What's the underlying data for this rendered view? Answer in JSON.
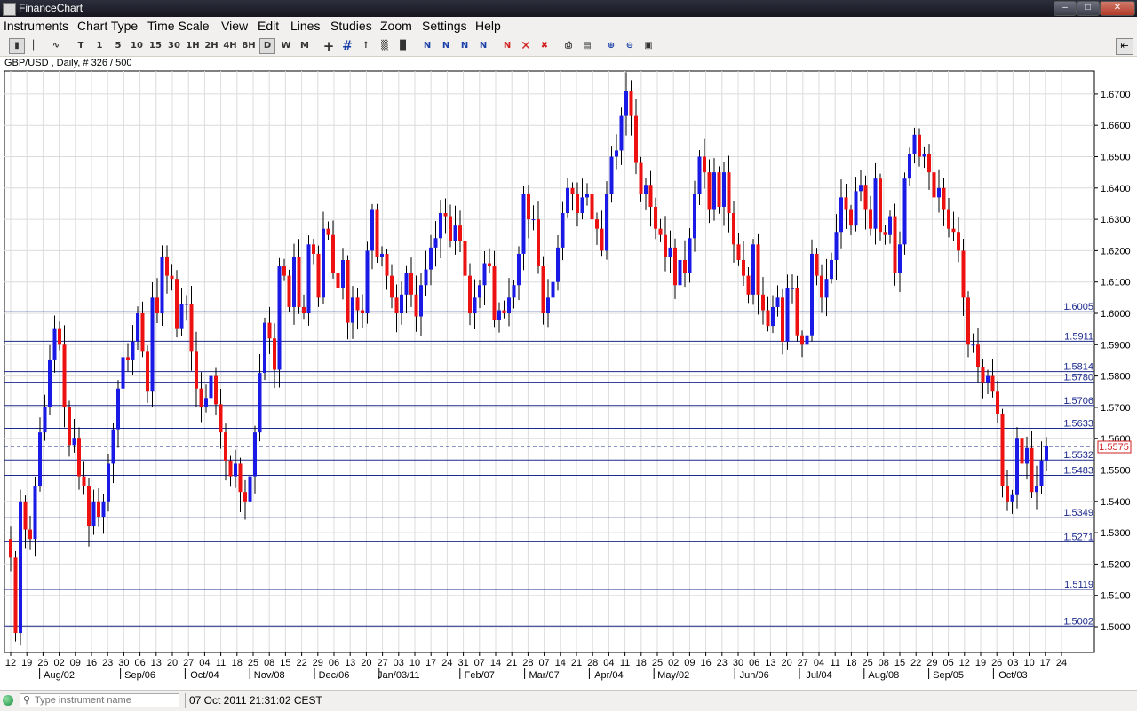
{
  "window": {
    "title": "FinanceChart"
  },
  "menu": [
    "Instruments",
    "Chart Type",
    "Time Scale",
    "View",
    "Edit",
    "Lines",
    "Studies",
    "Zoom",
    "Settings",
    "Help"
  ],
  "toolbar": {
    "timeframes": [
      "T",
      "1",
      "5",
      "10",
      "15",
      "30",
      "1H",
      "2H",
      "4H",
      "8H",
      "D",
      "W",
      "M"
    ],
    "selected_timeframe": "D"
  },
  "symbol_label": "GBP/USD , Daily, # 326 / 500",
  "status": {
    "search_placeholder": "Type instrument name",
    "datetime": "07 Oct 2011 21:31:02 CEST"
  },
  "colors": {
    "up": "#1a1ae6",
    "down": "#ee1111",
    "wick": "#000000",
    "level_line": "#1c2a8c",
    "grid": "#dcdcdc"
  },
  "chart_data": {
    "type": "candlestick",
    "instrument": "GBP/USD",
    "timeframe": "Daily",
    "ylim": [
      1.494,
      1.678
    ],
    "y_ticks": [
      "1.5000",
      "1.5100",
      "1.5200",
      "1.5300",
      "1.5400",
      "1.5500",
      "1.5600",
      "1.5700",
      "1.5800",
      "1.5900",
      "1.6000",
      "1.6100",
      "1.6200",
      "1.6300",
      "1.6400",
      "1.6500",
      "1.6600",
      "1.6700"
    ],
    "x_ticks": [
      "12",
      "19",
      "26",
      "02",
      "09",
      "16",
      "23",
      "30",
      "06",
      "13",
      "20",
      "27",
      "04",
      "11",
      "18",
      "25",
      "08",
      "15",
      "22",
      "29",
      "06",
      "13",
      "20",
      "27",
      "03",
      "10",
      "17",
      "24",
      "31",
      "07",
      "14",
      "21",
      "28",
      "07",
      "14",
      "21",
      "28",
      "04",
      "11",
      "18",
      "25",
      "02",
      "09",
      "16",
      "23",
      "30",
      "06",
      "13",
      "20",
      "27",
      "04",
      "11",
      "18",
      "25",
      "08",
      "15",
      "22",
      "29",
      "05",
      "12",
      "19",
      "26",
      "03",
      "10",
      "17",
      "24"
    ],
    "month_labels": [
      {
        "label": "Aug/02",
        "tick": 3
      },
      {
        "label": "Sep/06",
        "tick": 8
      },
      {
        "label": "Oct/04",
        "tick": 12
      },
      {
        "label": "Nov/08",
        "tick": 16
      },
      {
        "label": "Dec/06",
        "tick": 20
      },
      {
        "label": "Jan/03/11",
        "tick": 24
      },
      {
        "label": "Feb/07",
        "tick": 29
      },
      {
        "label": "Mar/07",
        "tick": 33
      },
      {
        "label": "Apr/04",
        "tick": 37
      },
      {
        "label": "May/02",
        "tick": 41
      },
      {
        "label": "Jun/06",
        "tick": 46
      },
      {
        "label": "Jul/04",
        "tick": 50
      },
      {
        "label": "Aug/08",
        "tick": 54
      },
      {
        "label": "Sep/05",
        "tick": 58
      },
      {
        "label": "Oct/03",
        "tick": 62
      }
    ],
    "levels": [
      "1.6005",
      "1.5911",
      "1.5814",
      "1.5780",
      "1.5706",
      "1.5633",
      "1.5532",
      "1.5483",
      "1.5349",
      "1.5271",
      "1.5119",
      "1.5002"
    ],
    "current_price": "1.5575",
    "close_path": [
      [
        0,
        1.522
      ],
      [
        1,
        1.498
      ],
      [
        2,
        1.54
      ],
      [
        3,
        1.531
      ],
      [
        4,
        1.528
      ],
      [
        5,
        1.545
      ],
      [
        6,
        1.562
      ],
      [
        7,
        1.57
      ],
      [
        8,
        1.585
      ],
      [
        9,
        1.595
      ],
      [
        10,
        1.59
      ],
      [
        11,
        1.57
      ],
      [
        12,
        1.558
      ],
      [
        13,
        1.56
      ],
      [
        14,
        1.548
      ],
      [
        15,
        1.545
      ],
      [
        16,
        1.532
      ],
      [
        17,
        1.54
      ],
      [
        18,
        1.535
      ],
      [
        19,
        1.54
      ],
      [
        20,
        1.552
      ],
      [
        21,
        1.563
      ],
      [
        22,
        1.576
      ],
      [
        23,
        1.586
      ],
      [
        24,
        1.585
      ],
      [
        25,
        1.591
      ],
      [
        26,
        1.6
      ],
      [
        27,
        1.588
      ],
      [
        28,
        1.575
      ],
      [
        29,
        1.605
      ],
      [
        30,
        1.6
      ],
      [
        31,
        1.618
      ],
      [
        32,
        1.612
      ],
      [
        33,
        1.611
      ],
      [
        34,
        1.595
      ],
      [
        35,
        1.603
      ],
      [
        36,
        1.603
      ],
      [
        37,
        1.588
      ],
      [
        38,
        1.576
      ],
      [
        39,
        1.57
      ],
      [
        40,
        1.573
      ],
      [
        41,
        1.58
      ],
      [
        42,
        1.571
      ],
      [
        43,
        1.562
      ],
      [
        44,
        1.553
      ],
      [
        45,
        1.548
      ],
      [
        46,
        1.552
      ],
      [
        47,
        1.543
      ],
      [
        48,
        1.54
      ],
      [
        49,
        1.548
      ],
      [
        50,
        1.562
      ],
      [
        51,
        1.581
      ],
      [
        52,
        1.597
      ],
      [
        53,
        1.592
      ],
      [
        54,
        1.582
      ],
      [
        55,
        1.615
      ],
      [
        56,
        1.612
      ],
      [
        57,
        1.602
      ],
      [
        58,
        1.618
      ],
      [
        59,
        1.602
      ],
      [
        60,
        1.6
      ],
      [
        61,
        1.622
      ],
      [
        62,
        1.619
      ],
      [
        63,
        1.605
      ],
      [
        64,
        1.627
      ],
      [
        65,
        1.625
      ],
      [
        66,
        1.613
      ],
      [
        67,
        1.608
      ],
      [
        68,
        1.617
      ],
      [
        69,
        1.597
      ],
      [
        70,
        1.605
      ],
      [
        71,
        1.601
      ],
      [
        72,
        1.6
      ],
      [
        73,
        1.62
      ],
      [
        74,
        1.633
      ],
      [
        75,
        1.618
      ],
      [
        76,
        1.619
      ],
      [
        77,
        1.612
      ],
      [
        78,
        1.605
      ],
      [
        79,
        1.6
      ],
      [
        80,
        1.606
      ],
      [
        81,
        1.613
      ],
      [
        82,
        1.606
      ],
      [
        83,
        1.599
      ],
      [
        84,
        1.609
      ],
      [
        85,
        1.614
      ],
      [
        86,
        1.621
      ],
      [
        87,
        1.624
      ],
      [
        88,
        1.632
      ],
      [
        89,
        1.631
      ],
      [
        90,
        1.623
      ],
      [
        91,
        1.628
      ],
      [
        92,
        1.623
      ],
      [
        93,
        1.612
      ],
      [
        94,
        1.6
      ],
      [
        95,
        1.605
      ],
      [
        96,
        1.609
      ],
      [
        97,
        1.616
      ],
      [
        98,
        1.615
      ],
      [
        99,
        1.598
      ],
      [
        100,
        1.601
      ],
      [
        101,
        1.6
      ],
      [
        102,
        1.605
      ],
      [
        103,
        1.609
      ],
      [
        104,
        1.619
      ],
      [
        105,
        1.638
      ],
      [
        106,
        1.63
      ],
      [
        107,
        1.63
      ],
      [
        108,
        1.615
      ],
      [
        109,
        1.6
      ],
      [
        110,
        1.605
      ],
      [
        111,
        1.61
      ],
      [
        112,
        1.621
      ],
      [
        113,
        1.632
      ],
      [
        114,
        1.64
      ],
      [
        115,
        1.638
      ],
      [
        116,
        1.632
      ],
      [
        117,
        1.637
      ],
      [
        118,
        1.638
      ],
      [
        119,
        1.63
      ],
      [
        120,
        1.627
      ],
      [
        121,
        1.62
      ],
      [
        122,
        1.638
      ],
      [
        123,
        1.65
      ],
      [
        124,
        1.652
      ],
      [
        125,
        1.663
      ],
      [
        126,
        1.671
      ],
      [
        127,
        1.663
      ],
      [
        128,
        1.648
      ],
      [
        129,
        1.638
      ],
      [
        130,
        1.641
      ],
      [
        131,
        1.634
      ],
      [
        132,
        1.627
      ],
      [
        133,
        1.625
      ],
      [
        134,
        1.618
      ],
      [
        135,
        1.621
      ],
      [
        136,
        1.609
      ],
      [
        137,
        1.617
      ],
      [
        138,
        1.613
      ],
      [
        139,
        1.624
      ],
      [
        140,
        1.638
      ],
      [
        141,
        1.65
      ],
      [
        142,
        1.645
      ],
      [
        143,
        1.633
      ],
      [
        144,
        1.645
      ],
      [
        145,
        1.634
      ],
      [
        146,
        1.645
      ],
      [
        147,
        1.632
      ],
      [
        148,
        1.622
      ],
      [
        149,
        1.617
      ],
      [
        150,
        1.612
      ],
      [
        151,
        1.606
      ],
      [
        152,
        1.622
      ],
      [
        153,
        1.606
      ],
      [
        154,
        1.601
      ],
      [
        155,
        1.596
      ],
      [
        156,
        1.602
      ],
      [
        157,
        1.605
      ],
      [
        158,
        1.591
      ],
      [
        159,
        1.608
      ],
      [
        160,
        1.608
      ],
      [
        161,
        1.593
      ],
      [
        162,
        1.59
      ],
      [
        163,
        1.593
      ],
      [
        164,
        1.619
      ],
      [
        165,
        1.612
      ],
      [
        166,
        1.605
      ],
      [
        167,
        1.611
      ],
      [
        168,
        1.617
      ],
      [
        169,
        1.626
      ],
      [
        170,
        1.637
      ],
      [
        171,
        1.633
      ],
      [
        172,
        1.628
      ],
      [
        173,
        1.639
      ],
      [
        174,
        1.641
      ],
      [
        175,
        1.633
      ],
      [
        176,
        1.627
      ],
      [
        177,
        1.643
      ],
      [
        178,
        1.626
      ],
      [
        179,
        1.625
      ],
      [
        180,
        1.631
      ],
      [
        181,
        1.613
      ],
      [
        182,
        1.622
      ],
      [
        183,
        1.643
      ],
      [
        184,
        1.651
      ],
      [
        185,
        1.657
      ],
      [
        186,
        1.65
      ],
      [
        187,
        1.651
      ],
      [
        188,
        1.645
      ],
      [
        189,
        1.637
      ],
      [
        190,
        1.64
      ],
      [
        191,
        1.633
      ],
      [
        192,
        1.627
      ],
      [
        193,
        1.626
      ],
      [
        194,
        1.62
      ],
      [
        195,
        1.605
      ],
      [
        196,
        1.59
      ],
      [
        197,
        1.59
      ],
      [
        198,
        1.583
      ],
      [
        199,
        1.578
      ],
      [
        200,
        1.58
      ],
      [
        201,
        1.575
      ],
      [
        202,
        1.568
      ],
      [
        203,
        1.545
      ],
      [
        204,
        1.54
      ],
      [
        205,
        1.542
      ],
      [
        206,
        1.56
      ],
      [
        207,
        1.552
      ],
      [
        208,
        1.557
      ],
      [
        209,
        1.543
      ],
      [
        210,
        1.545
      ],
      [
        211,
        1.553
      ],
      [
        212,
        1.5575
      ]
    ]
  }
}
